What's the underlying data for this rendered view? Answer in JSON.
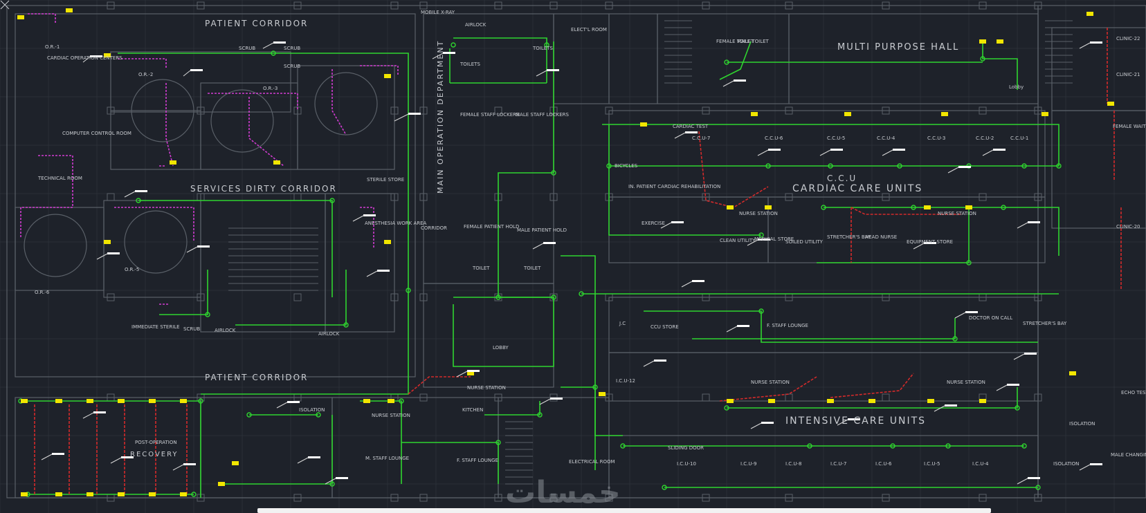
{
  "drawing": {
    "colors": {
      "background": "#1e222a",
      "walls": "#5a6068",
      "grid": "#2a2f37",
      "circuit_main": "#2fd52f",
      "circuit_magenta": "#d23cd2",
      "circuit_red": "#d42a2a",
      "device_yellow": "#f2e600",
      "label_white": "#ffffff",
      "text": "#c9ccd1"
    },
    "rooms_large": [
      {
        "id": "patient-corridor-top",
        "text": "PATIENT CORRIDOR"
      },
      {
        "id": "services-dirty-corridor",
        "text": "SERVICES DIRTY CORRIDOR"
      },
      {
        "id": "patient-corridor-bottom",
        "text": "PATIENT CORRIDOR"
      },
      {
        "id": "main-operation-department",
        "text": "MAIN OPERATION DEPARTMENT"
      },
      {
        "id": "multi-purpose-hall",
        "text": "MULTI PURPOSE HALL"
      },
      {
        "id": "ccu",
        "text": "C.C.U"
      },
      {
        "id": "cardiac-care-units",
        "text": "CARDIAC CARE UNITS"
      },
      {
        "id": "intensive-care-units",
        "text": "INTENSIVE CARE UNITS"
      },
      {
        "id": "post-operation-recovery",
        "text": "RECOVERY"
      }
    ],
    "rooms_small": [
      {
        "id": "or1",
        "text": "O.R.-1"
      },
      {
        "id": "or2",
        "text": "O.R.-2"
      },
      {
        "id": "or3",
        "text": "O.R.-3"
      },
      {
        "id": "or5",
        "text": "O.R.-5"
      },
      {
        "id": "or6",
        "text": "O.R.-6"
      },
      {
        "id": "cardiac-op-centers",
        "text": "CARDIAC OPERATION CENTERS"
      },
      {
        "id": "computer-control",
        "text": "COMPUTER CONTROL ROOM"
      },
      {
        "id": "technical-room",
        "text": "TECHNICAL ROOM"
      },
      {
        "id": "scrub1",
        "text": "SCRUB"
      },
      {
        "id": "scrub2",
        "text": "SCRUB"
      },
      {
        "id": "scrub3",
        "text": "SCRUB"
      },
      {
        "id": "scrub4",
        "text": "SCRUB"
      },
      {
        "id": "mobile-xray",
        "text": "MOBILE X-RAY"
      },
      {
        "id": "airlock1",
        "text": "AIRLOCK"
      },
      {
        "id": "toilets1",
        "text": "TOILETS"
      },
      {
        "id": "toilets2",
        "text": "TOILETS"
      },
      {
        "id": "electl-room",
        "text": "ELECT'L ROOM"
      },
      {
        "id": "female-staff-lockers",
        "text": "FEMALE STAFF LOCKERS"
      },
      {
        "id": "male-staff-lockers",
        "text": "MALE STAFF LOCKERS"
      },
      {
        "id": "female-toilet",
        "text": "FEMALE TOILET"
      },
      {
        "id": "male-toilet",
        "text": "MALE TOILET"
      },
      {
        "id": "sterile-store",
        "text": "STERILE STORE"
      },
      {
        "id": "anesthesia-work-area",
        "text": "ANESTHESIA WORK AREA"
      },
      {
        "id": "corridor",
        "text": "CORRIDOR"
      },
      {
        "id": "female-patient-hold",
        "text": "FEMALE PATIENT HOLD"
      },
      {
        "id": "male-patient-hold",
        "text": "MALE PATIENT HOLD"
      },
      {
        "id": "toilet-a",
        "text": "TOILET"
      },
      {
        "id": "toilet-b",
        "text": "TOILET"
      },
      {
        "id": "lobby",
        "text": "LOBBY"
      },
      {
        "id": "nurse-station-main",
        "text": "NURSE STATION"
      },
      {
        "id": "kitchen",
        "text": "KITCHEN"
      },
      {
        "id": "isolation",
        "text": "ISOLATION"
      },
      {
        "id": "nurse-station-2",
        "text": "NURSE STATION"
      },
      {
        "id": "m-staff-lounge",
        "text": "M. STAFF LOUNGE"
      },
      {
        "id": "f-staff-lounge",
        "text": "F. STAFF LOUNGE"
      },
      {
        "id": "electrical-room",
        "text": "ELECTRICAL ROOM"
      },
      {
        "id": "post-operation",
        "text": "POST-OPERATION"
      },
      {
        "id": "airlock2",
        "text": "AIRLOCK"
      },
      {
        "id": "airlock3",
        "text": "AIRLOCK"
      },
      {
        "id": "immediate-sterile",
        "text": "IMMEDIATE STERILE"
      },
      {
        "id": "ccu7",
        "text": "C.C.U-7"
      },
      {
        "id": "ccu6",
        "text": "C.C.U-6"
      },
      {
        "id": "ccu5",
        "text": "C.C.U-5"
      },
      {
        "id": "ccu4",
        "text": "C.C.U-4"
      },
      {
        "id": "ccu3",
        "text": "C.C.U-3"
      },
      {
        "id": "ccu2",
        "text": "C.C.U-2"
      },
      {
        "id": "ccu1",
        "text": "C.C.U-1"
      },
      {
        "id": "cardiac-rehab",
        "text": "IN. PATIENT CARDIAC REHABILITATION"
      },
      {
        "id": "bicycles",
        "text": "BICYCLES"
      },
      {
        "id": "exercise",
        "text": "EXERCISE"
      },
      {
        "id": "nurse-station-ccu-a",
        "text": "NURSE STATION"
      },
      {
        "id": "nurse-station-ccu-b",
        "text": "NURSE STATION"
      },
      {
        "id": "head-nurse",
        "text": "HEAD NURSE"
      },
      {
        "id": "clean-utility",
        "text": "CLEAN UTILITY"
      },
      {
        "id": "medical-store",
        "text": "MEDICAL STORE"
      },
      {
        "id": "soiled-utility",
        "text": "SOILED UTILITY"
      },
      {
        "id": "stretchers-bay",
        "text": "STRETCHER'S BAY"
      },
      {
        "id": "equipment-store",
        "text": "EQUIPMENT STORE"
      },
      {
        "id": "lobby2",
        "text": "Lobby"
      },
      {
        "id": "female-waiting",
        "text": "FEMALE WAITING"
      },
      {
        "id": "clinic22",
        "text": "CLINIC-22"
      },
      {
        "id": "clinic21",
        "text": "CLINIC-21"
      },
      {
        "id": "clinic20",
        "text": "CLINIC-20"
      },
      {
        "id": "icu12",
        "text": "I.C.U-12"
      },
      {
        "id": "icu10",
        "text": "I.C.U-10"
      },
      {
        "id": "icu9",
        "text": "I.C.U-9"
      },
      {
        "id": "icu8",
        "text": "I.C.U-8"
      },
      {
        "id": "icu7",
        "text": "I.C.U-7"
      },
      {
        "id": "icu6",
        "text": "I.C.U-6"
      },
      {
        "id": "icu5",
        "text": "I.C.U-5"
      },
      {
        "id": "icu4",
        "text": "I.C.U-4"
      },
      {
        "id": "nurse-station-icu-a",
        "text": "NURSE STATION"
      },
      {
        "id": "nurse-station-icu-b",
        "text": "NURSE STATION"
      },
      {
        "id": "f-staff-lounge-2",
        "text": "F. STAFF LOUNGE"
      },
      {
        "id": "doctor-on-call",
        "text": "DOCTOR ON CALL"
      },
      {
        "id": "stretchers-bay-2",
        "text": "STRETCHER'S BAY"
      },
      {
        "id": "janitor",
        "text": "J.C"
      },
      {
        "id": "sliding-door",
        "text": "SLIDING DOOR"
      },
      {
        "id": "isolation2",
        "text": "ISOLATION"
      },
      {
        "id": "isolation3",
        "text": "ISOLATION"
      },
      {
        "id": "male-changing",
        "text": "MALE CHANGING LOCKER ROOM"
      },
      {
        "id": "echo-test",
        "text": "ECHO TEST"
      },
      {
        "id": "ccu-store",
        "text": "CCU STORE"
      },
      {
        "id": "cardiac-test",
        "text": "CARDIAC TEST"
      }
    ],
    "watermark": "خمسات"
  }
}
